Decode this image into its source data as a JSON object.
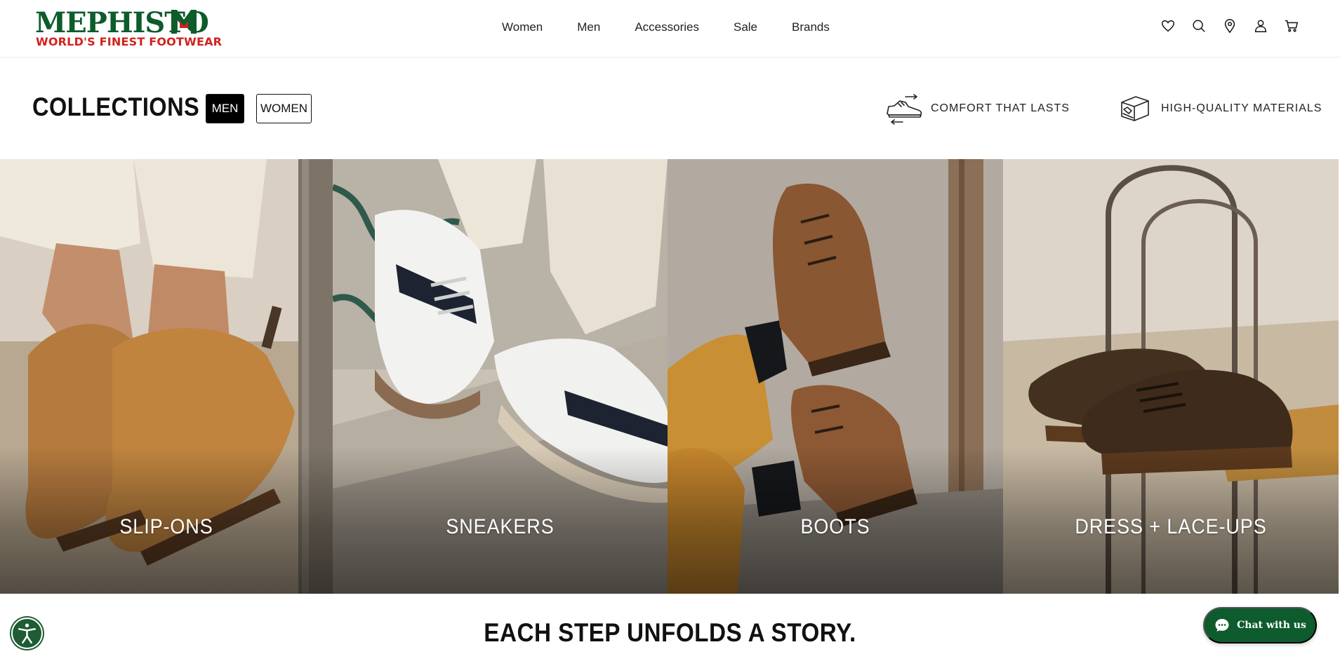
{
  "brand": {
    "name": "MEPHISTO",
    "tagline": "WORLD'S FINEST FOOTWEAR",
    "green": "#0d5c2c",
    "red": "#d0231f"
  },
  "nav": {
    "items": [
      {
        "label": "Women"
      },
      {
        "label": "Men"
      },
      {
        "label": "Accessories"
      },
      {
        "label": "Sale"
      },
      {
        "label": "Brands"
      }
    ]
  },
  "header_icons": [
    "heart-icon",
    "search-icon",
    "location-pin-icon",
    "account-icon",
    "cart-icon"
  ],
  "collections": {
    "title": "COLLECTIONS",
    "filters": [
      {
        "label": "MEN",
        "selected": true
      },
      {
        "label": "WOMEN",
        "selected": false
      }
    ],
    "features": [
      {
        "label": "COMFORT THAT LASTS",
        "icon": "shoe-comfort-icon"
      },
      {
        "label": "HIGH-QUALITY MATERIALS",
        "icon": "shoe-materials-icon"
      }
    ]
  },
  "tiles": [
    {
      "label": "SLIP-ONS"
    },
    {
      "label": "SNEAKERS"
    },
    {
      "label": "BOOTS"
    },
    {
      "label": "DRESS + LACE-UPS"
    }
  ],
  "story": {
    "heading": "EACH STEP UNFOLDS A STORY."
  },
  "widgets": {
    "accessibility_icon": "accessibility-icon",
    "chat_label": "Chat with us",
    "chat_color": "#0e5b2d"
  }
}
